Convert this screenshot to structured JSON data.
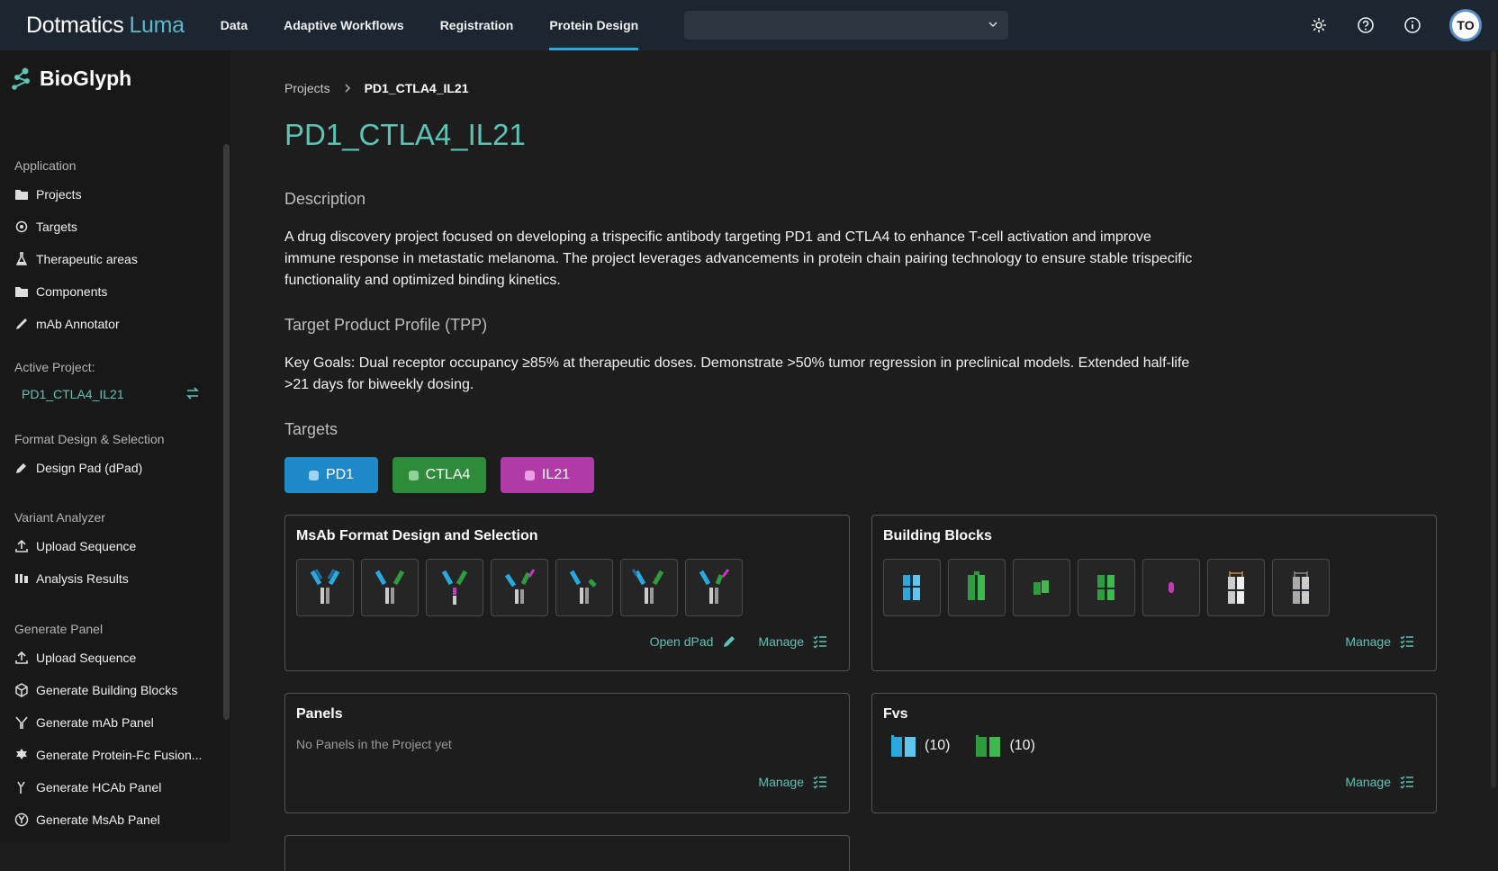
{
  "topbar": {
    "brand_main": "Dotmatics",
    "brand_sub": "Luma",
    "nav": [
      "Data",
      "Adaptive Workflows",
      "Registration",
      "Protein Design"
    ],
    "active_nav": "Protein Design",
    "avatar_initials": "TO"
  },
  "sidebar": {
    "app_name": "BioGlyph",
    "application_heading": "Application",
    "application_items": [
      "Projects",
      "Targets",
      "Therapeutic areas",
      "Components",
      "mAb Annotator"
    ],
    "active_project_heading": "Active Project:",
    "active_project": "PD1_CTLA4_IL21",
    "format_heading": "Format Design & Selection",
    "format_items": [
      "Design Pad (dPad)"
    ],
    "variant_heading": "Variant Analyzer",
    "variant_items": [
      "Upload Sequence",
      "Analysis Results"
    ],
    "generate_heading": "Generate Panel",
    "generate_items": [
      "Upload Sequence",
      "Generate Building Blocks",
      "Generate mAb Panel",
      "Generate Protein-Fc Fusion...",
      "Generate HCAb Panel",
      "Generate MsAb Panel"
    ]
  },
  "main": {
    "breadcrumb_root": "Projects",
    "breadcrumb_current": "PD1_CTLA4_IL21",
    "title": "PD1_CTLA4_IL21",
    "description_heading": "Description",
    "description": "A drug discovery project focused on developing a trispecific antibody targeting PD1 and CTLA4 to enhance T-cell activation and improve immune response in metastatic melanoma. The project leverages advancements in protein chain pairing technology to ensure stable trispecific functionality and optimized binding kinetics.",
    "tpp_heading": "Target Product Profile (TPP)",
    "tpp": "Key Goals: Dual receptor occupancy ≥85% at therapeutic doses. Demonstrate >50% tumor regression in preclinical models. Extended half-life >21 days for biweekly dosing.",
    "targets_heading": "Targets",
    "targets": [
      {
        "label": "PD1",
        "color": "#1e88c8"
      },
      {
        "label": "CTLA4",
        "color": "#2e8b3a"
      },
      {
        "label": "IL21",
        "color": "#b03aa8"
      }
    ]
  },
  "cards": {
    "msab_title": "MsAb Format Design and Selection",
    "open_dpad": "Open dPad",
    "manage": "Manage",
    "building_title": "Building Blocks",
    "panels_title": "Panels",
    "panels_empty": "No Panels in the Project yet",
    "fvs_title": "Fvs",
    "fv_counts": [
      "(10)",
      "(10)"
    ]
  },
  "colors": {
    "accent": "#5cc4b4",
    "blue": "#29a9e0",
    "green": "#2e9b3e",
    "magenta": "#c23bb8"
  }
}
